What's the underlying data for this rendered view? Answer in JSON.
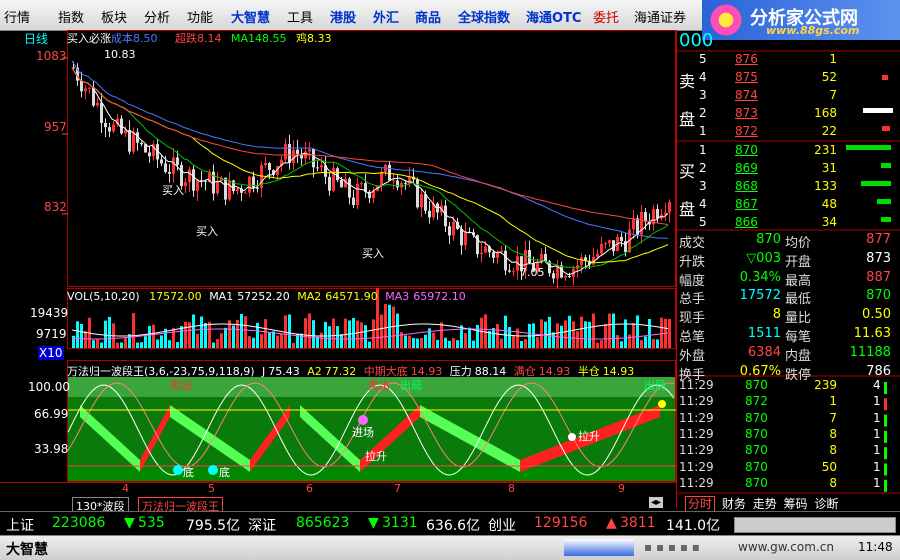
{
  "menu": [
    {
      "label": "行情",
      "style": "normal"
    },
    {
      "label": "指数",
      "style": "normal"
    },
    {
      "label": "板块",
      "style": "normal"
    },
    {
      "label": "分析",
      "style": "normal"
    },
    {
      "label": "功能",
      "style": "normal"
    },
    {
      "label": "大智慧",
      "style": "blue"
    },
    {
      "label": "工具",
      "style": "normal"
    },
    {
      "label": "港股",
      "style": "blue"
    },
    {
      "label": "外汇",
      "style": "blue"
    },
    {
      "label": "商品",
      "style": "blue"
    },
    {
      "label": "全球指数",
      "style": "blue"
    },
    {
      "label": "海通OTC",
      "style": "blue"
    },
    {
      "label": "委托",
      "style": "red"
    },
    {
      "label": "海通证券",
      "style": "normal"
    }
  ],
  "logo": {
    "title": "分析家公式网",
    "url": "www.88gs.com"
  },
  "stock_code": "000",
  "chart": {
    "period_label": "日线",
    "main_formula": {
      "name": "买入必涨",
      "cost_label": "成本",
      "cost": "8.50",
      "short_label": "超跌",
      "short": "8.14",
      "ma_label": "MA14",
      "ma": "8.55",
      "fish_label": "鸡",
      "fish": "8.33"
    },
    "price_axis": [
      "1083",
      "957",
      "832"
    ],
    "high_label": "10.83",
    "low_label": "7.05",
    "buy_signals": [
      "买入",
      "买入",
      "买入"
    ],
    "vol_formula": {
      "name": "VOL(5,10,20)",
      "vol": "17572.00",
      "ma1_label": "MA1",
      "ma1": "57252.20",
      "ma2_label": "MA2",
      "ma2": "64571.90",
      "ma3_label": "MA3",
      "ma3": "65972.10"
    },
    "vol_axis": [
      "19439",
      "9719",
      "X10"
    ],
    "ind_formula": {
      "name": "万法归一波段王",
      "params": "(3,6,-23,75,9,118,9)",
      "j_label": "J",
      "j": "75.43",
      "a2_label": "A2",
      "a2": "77.32",
      "mid_label": "中期大底",
      "mid": "14.93",
      "press_label": "压力",
      "press": "88.14",
      "full_label": "满仓",
      "full": "14.93",
      "half_label": "半仓",
      "half": "14.93"
    },
    "ind_axis": [
      "100.00",
      "66.99",
      "33.98"
    ],
    "ind_signals": {
      "sell": "卖出",
      "pull": "拉升",
      "out": "出局",
      "bottom": "底",
      "enter": "进场"
    },
    "month_labels": [
      "4",
      "5",
      "6",
      "7",
      "8",
      "9"
    ],
    "colors": {
      "up": "#ff3333",
      "down": "#dcdcdc",
      "ma_white": "#ffffff",
      "ma_yellow": "#ffff00",
      "ma_green": "#00c000",
      "ma_blue": "#4a78ff",
      "ma_red": "#ff4444",
      "band_green": "#00b400",
      "band_red": "#ff2020"
    }
  },
  "tabs": [
    {
      "label": "130*波段",
      "active": false
    },
    {
      "label": "万法归一波段王",
      "active": true
    }
  ],
  "right_tabs": [
    "分时",
    "财务",
    "走势",
    "筹码",
    "诊断"
  ],
  "orderbook": {
    "sell_label": [
      "卖",
      "盘"
    ],
    "buy_label": [
      "买",
      "盘"
    ],
    "sell": [
      {
        "lvl": "5",
        "price": "876",
        "vol": "1"
      },
      {
        "lvl": "4",
        "price": "875",
        "vol": "52"
      },
      {
        "lvl": "3",
        "price": "874",
        "vol": "7"
      },
      {
        "lvl": "2",
        "price": "873",
        "vol": "168"
      },
      {
        "lvl": "1",
        "price": "872",
        "vol": "22"
      }
    ],
    "buy": [
      {
        "lvl": "1",
        "price": "870",
        "vol": "231"
      },
      {
        "lvl": "2",
        "price": "869",
        "vol": "31"
      },
      {
        "lvl": "3",
        "price": "868",
        "vol": "133"
      },
      {
        "lvl": "4",
        "price": "867",
        "vol": "48"
      },
      {
        "lvl": "5",
        "price": "866",
        "vol": "34"
      }
    ]
  },
  "quote": [
    {
      "l1": "成交",
      "v1": "870",
      "l2": "均价",
      "v2": "877"
    },
    {
      "l1": "升跌",
      "v1": "▽003",
      "l2": "开盘",
      "v2": "873"
    },
    {
      "l1": "幅度",
      "v1": "0.34%",
      "l2": "最高",
      "v2": "887"
    },
    {
      "l1": "总手",
      "v1": "17572",
      "l2": "最低",
      "v2": "870"
    },
    {
      "l1": "现手",
      "v1": "8",
      "l2": "量比",
      "v2": "0.50"
    },
    {
      "l1": "总笔",
      "v1": "1511",
      "l2": "每笔",
      "v2": "11.63"
    },
    {
      "l1": "外盘",
      "v1": "6384",
      "l2": "内盘",
      "v2": "11188"
    },
    {
      "l1": "换手",
      "v1": "0.67%",
      "l2": "跌停",
      "v2": "786"
    }
  ],
  "ticks": [
    {
      "t": "11:29",
      "p": "870",
      "v": "239",
      "n": "4"
    },
    {
      "t": "11:29",
      "p": "872",
      "v": "1",
      "n": "1"
    },
    {
      "t": "11:29",
      "p": "870",
      "v": "7",
      "n": "1"
    },
    {
      "t": "11:29",
      "p": "870",
      "v": "8",
      "n": "1"
    },
    {
      "t": "11:29",
      "p": "870",
      "v": "8",
      "n": "1"
    },
    {
      "t": "11:29",
      "p": "870",
      "v": "50",
      "n": "1"
    },
    {
      "t": "11:29",
      "p": "870",
      "v": "8",
      "n": "1"
    }
  ],
  "status": {
    "sh_label": "上证",
    "sh_index": "223086",
    "sh_chg": "535",
    "sh_amt": "795.5亿",
    "sz_label": "深证",
    "sz_index": "865623",
    "sz_chg": "3131",
    "sz_amt": "636.6亿",
    "cy_label": "创业",
    "cy_index": "129156",
    "cy_chg": "3811",
    "cy_amt": "141.0亿"
  },
  "footer": {
    "brand": "大智慧",
    "url": "www.gw.com.cn",
    "time": "11:48"
  }
}
